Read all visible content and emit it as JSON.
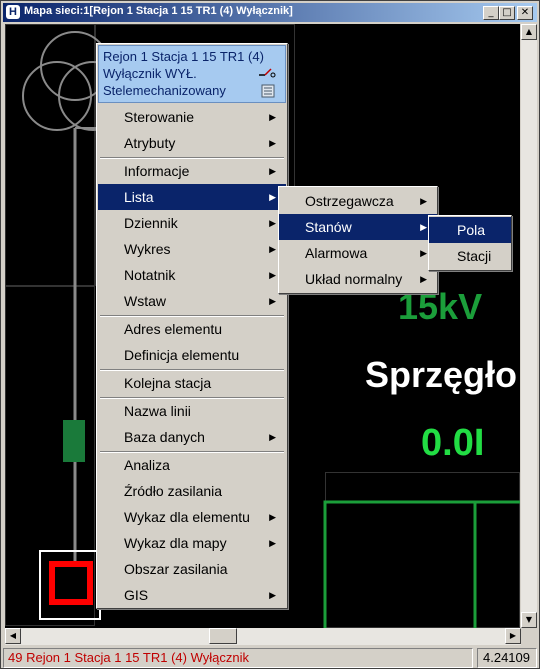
{
  "window": {
    "title": "Mapa sieci:1[Rejon 1 Stacja 1 15 TR1 (4) Wyłącznik]",
    "icon": "app-icon",
    "buttons": {
      "minimize": "_",
      "maximize": "□",
      "close": "✕"
    }
  },
  "canvas": {
    "label_voltage": "15kV",
    "label_coupler": "Sprzęgło",
    "label_value": "0.0I"
  },
  "context_menu": {
    "header": {
      "line1": "Rejon 1 Stacja 1 15 TR1 (4)",
      "line2": "Wyłącznik WYŁ.",
      "line3": "Stelemechanizowany"
    },
    "items": [
      {
        "label": "Sterowanie",
        "submenu": true
      },
      {
        "label": "Atrybuty",
        "submenu": true
      },
      {
        "label": "Informacje",
        "submenu": true
      },
      {
        "label": "Lista",
        "submenu": true,
        "selected": true
      },
      {
        "label": "Dziennik",
        "submenu": true
      },
      {
        "label": "Wykres",
        "submenu": true
      },
      {
        "label": "Notatnik",
        "submenu": true
      },
      {
        "label": "Wstaw",
        "submenu": true
      },
      {
        "label": "Adres elementu",
        "submenu": false
      },
      {
        "label": "Definicja elementu",
        "submenu": false
      },
      {
        "label": "Kolejna stacja",
        "submenu": false
      },
      {
        "label": "Nazwa linii",
        "submenu": false
      },
      {
        "label": "Baza danych",
        "submenu": true
      },
      {
        "label": "Analiza",
        "submenu": false
      },
      {
        "label": "Źródło zasilania",
        "submenu": false
      },
      {
        "label": "Wykaz dla elementu",
        "submenu": true
      },
      {
        "label": "Wykaz dla mapy",
        "submenu": true
      },
      {
        "label": "Obszar zasilania",
        "submenu": false
      },
      {
        "label": "GIS",
        "submenu": true
      }
    ]
  },
  "submenu_lista": {
    "items": [
      {
        "label": "Ostrzegawcza",
        "submenu": true
      },
      {
        "label": "Stanów",
        "submenu": true,
        "selected": true
      },
      {
        "label": "Alarmowa",
        "submenu": true
      },
      {
        "label": "Układ normalny",
        "submenu": true
      }
    ]
  },
  "submenu_stanow": {
    "items": [
      {
        "label": "Pola",
        "selected": true
      },
      {
        "label": "Stacji"
      }
    ]
  },
  "status": {
    "left": "49 Rejon 1 Stacja 1 15 TR1 (4) Wyłącznik",
    "right": "4.24109"
  },
  "colors": {
    "selection": "#0a246a",
    "status_text": "#c00000",
    "green": "#1b9e3a",
    "menu_header_bg": "#a6caf0"
  },
  "icons": {
    "arrow": "▸",
    "switch_icon": "switch-icon",
    "telemetry_icon": "telemetry-icon"
  }
}
